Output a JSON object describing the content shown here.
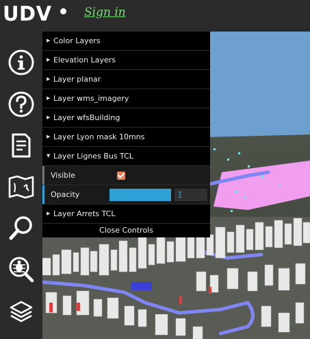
{
  "header": {
    "logo": "UDV",
    "signin": "Sign in"
  },
  "sidebar": {
    "items": [
      {
        "icon": "info-icon"
      },
      {
        "icon": "help-icon"
      },
      {
        "icon": "document-icon"
      },
      {
        "icon": "map-icon"
      },
      {
        "icon": "search-icon"
      },
      {
        "icon": "bug-search-icon"
      },
      {
        "icon": "layers-icon"
      }
    ]
  },
  "controls": {
    "folders": [
      "Color Layers",
      "Elevation Layers",
      "Layer planar",
      "Layer wms_imagery",
      "Layer wfsBuilding",
      "Layer Lyon mask 10mns",
      "Layer Lignes Bus TCL"
    ],
    "open_folder": {
      "visible_label": "Visible",
      "visible_checked": true,
      "opacity_label": "Opacity",
      "opacity_value": "1",
      "opacity_fraction": 1.0
    },
    "after_folders": [
      "Layer Arrets TCL"
    ],
    "close_label": "Close Controls"
  },
  "colors": {
    "accent": "#2fa1d6",
    "checkbox": "#e8825a",
    "signin": "#7cdc7c",
    "sky": "#6d9fd0",
    "mask": "#f19ef0",
    "bus_line": "#7f86f3"
  }
}
